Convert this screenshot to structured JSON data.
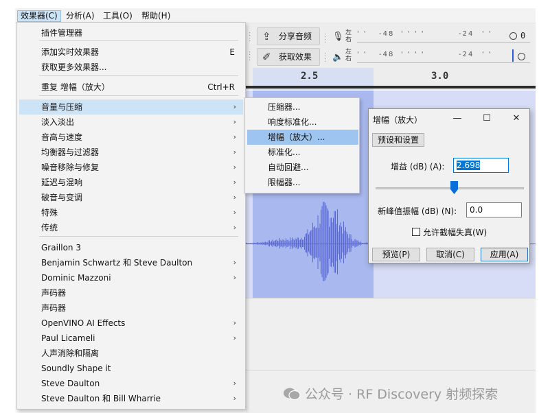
{
  "menubar": {
    "items": [
      "效果器(C)",
      "分析(A)",
      "工具(O)",
      "帮助(H)"
    ]
  },
  "toolbar": {
    "share_audio": "分享音频",
    "get_effects": "获取效果",
    "rec_meter": {
      "left": "左",
      "right": "右",
      "ticks": [
        "-48",
        "-24",
        "0"
      ],
      "value": "0"
    },
    "play_meter": {
      "left": "左",
      "right": "右",
      "ticks": [
        "-48",
        "-24"
      ]
    }
  },
  "timeline": {
    "labels": [
      "2.5",
      "3.0"
    ]
  },
  "effects_menu": {
    "items": [
      {
        "label": "插件管理器"
      },
      {
        "label": "添加实时效果器",
        "shortcut": "E"
      },
      {
        "label": "获取更多效果器..."
      },
      {
        "label": "重复 增幅（放大）",
        "shortcut": "Ctrl+R"
      },
      {
        "label": "音量与压缩",
        "submenu": true,
        "highlighted": true
      },
      {
        "label": "淡入淡出",
        "submenu": true
      },
      {
        "label": "音高与速度",
        "submenu": true
      },
      {
        "label": "均衡器与过滤器",
        "submenu": true
      },
      {
        "label": "噪音移除与修复",
        "submenu": true
      },
      {
        "label": "延迟与混响",
        "submenu": true
      },
      {
        "label": "破音与变调",
        "submenu": true
      },
      {
        "label": "特殊",
        "submenu": true
      },
      {
        "label": "传统",
        "submenu": true
      },
      {
        "label": "Graillon 3"
      },
      {
        "label": "Benjamin Schwartz 和 Steve Daulton",
        "submenu": true
      },
      {
        "label": "Dominic Mazzoni",
        "submenu": true
      },
      {
        "label": "声码器"
      },
      {
        "label": "声码器"
      },
      {
        "label": "OpenVINO AI Effects",
        "submenu": true
      },
      {
        "label": "Paul Licameli",
        "submenu": true
      },
      {
        "label": "人声消除和隔离"
      },
      {
        "label": "Soundly Shape it"
      },
      {
        "label": "Steve Daulton",
        "submenu": true
      },
      {
        "label": "Steve Daulton 和 Bill Wharrie",
        "submenu": true
      }
    ]
  },
  "volume_submenu": {
    "items": [
      "压缩器...",
      "响度标准化...",
      "增幅（放大）...",
      "标准化...",
      "自动回避...",
      "限幅器..."
    ],
    "highlighted_index": 2
  },
  "amplify_dialog": {
    "title": "增幅（放大）",
    "presets_button": "预设和设置",
    "gain_label": "增益 (dB) (A):",
    "gain_value": "2.698",
    "gain_slider_position": 0.53,
    "new_peak_label": "新峰值振幅 (dB) (N):",
    "new_peak_value": "0.0",
    "allow_clipping_label": "允许截幅失真(W)",
    "allow_clipping_checked": false,
    "preview_button": "预览(P)",
    "cancel_button": "取消(C)",
    "apply_button": "应用(A)"
  },
  "watermark": {
    "text": "公众号 · RF Discovery 射频探索"
  },
  "colors": {
    "menu_highlight": "#cde4f7",
    "submenu_highlight": "#9ec5ef",
    "waveform": "#5a68d6",
    "selection": "#a9b8ee",
    "text_selection": "#0078d7"
  }
}
